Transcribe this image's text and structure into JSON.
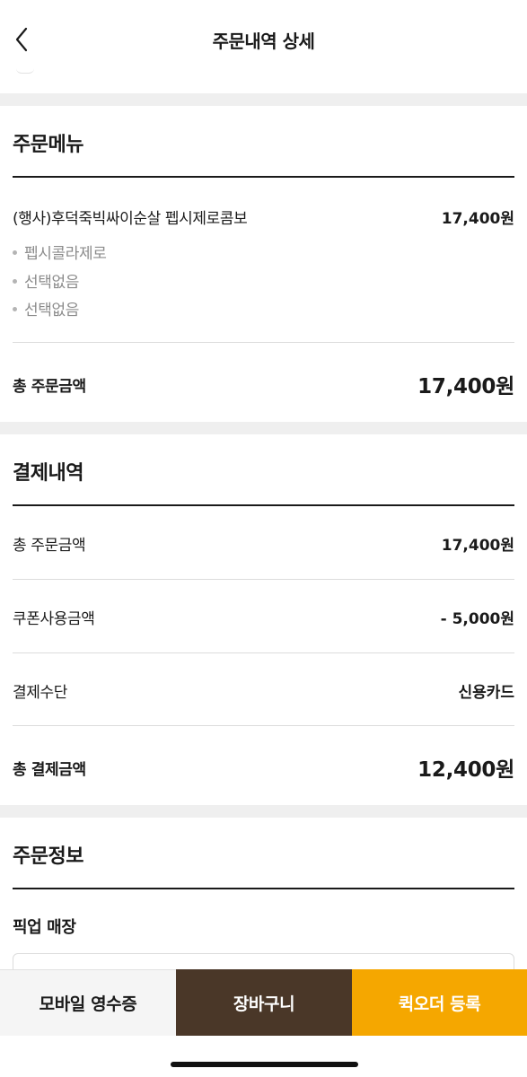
{
  "header": {
    "title": "주문내역 상세",
    "back_icon": "chevron-left-icon"
  },
  "order_menu": {
    "title": "주문메뉴",
    "item": {
      "name": "(행사)후덕죽빅싸이순살 펩시제로콤보",
      "price": "17,400원",
      "options": [
        "펩시콜라제로",
        "선택없음",
        "선택없음"
      ]
    },
    "total_label": "총 주문금액",
    "total_value": "17,400원"
  },
  "payment": {
    "title": "결제내역",
    "rows": [
      {
        "label": "총 주문금액",
        "value": "17,400원"
      },
      {
        "label": "쿠폰사용금액",
        "value": "- 5,000원"
      },
      {
        "label": "결제수단",
        "value": "신용카드"
      }
    ],
    "total_label": "총 결제금액",
    "total_value": "12,400원"
  },
  "order_info": {
    "title": "주문정보",
    "pickup_label": "픽업 매장"
  },
  "bottom_bar": {
    "receipt_label": "모바일 영수증",
    "cart_label": "장바구니",
    "quick_order_label": "퀵오더 등록"
  },
  "colors": {
    "cart_bg": "#4a3728",
    "quick_order_bg": "#f5a700",
    "receipt_bg": "#f5f5f5",
    "section_gap": "#efefef"
  }
}
